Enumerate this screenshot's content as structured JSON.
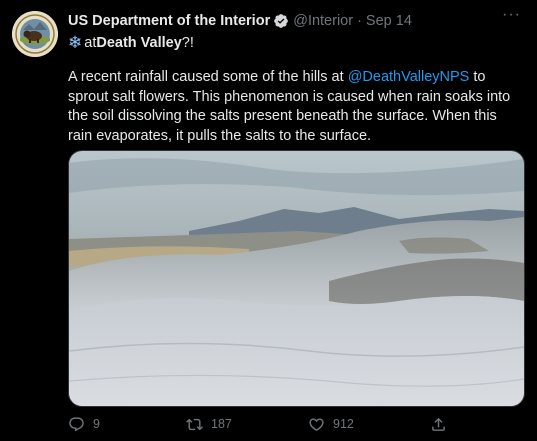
{
  "tweet": {
    "author_name": "US Department of the Interior",
    "handle": "@Interior",
    "separator": "·",
    "date": "Sep 14",
    "more_label": "···",
    "headline_emoji": "❄",
    "headline_prefix": "at ",
    "headline_bold": "Death Valley",
    "headline_suffix": "?!",
    "body_part1": "A recent rainfall caused some of the hills at ",
    "mention": "@DeathValleyNPS",
    "body_part2": " to sprout salt flowers. This phenomenon is caused when rain soaks into the soil dissolving the salts present beneath the surface. When this rain evaporates, it pulls the salts to the surface."
  },
  "actions": {
    "reply_count": "9",
    "retweet_count": "187",
    "like_count": "912"
  },
  "icons": {
    "avatar": "interior-seal-icon",
    "verified": "verified-badge-icon",
    "more": "more-dots-icon",
    "reply": "reply-icon",
    "retweet": "retweet-icon",
    "like": "heart-icon",
    "share": "share-icon"
  },
  "colors": {
    "background": "#000000",
    "text": "#e7e9ea",
    "secondary": "#71767b",
    "link": "#1d9bf0"
  }
}
